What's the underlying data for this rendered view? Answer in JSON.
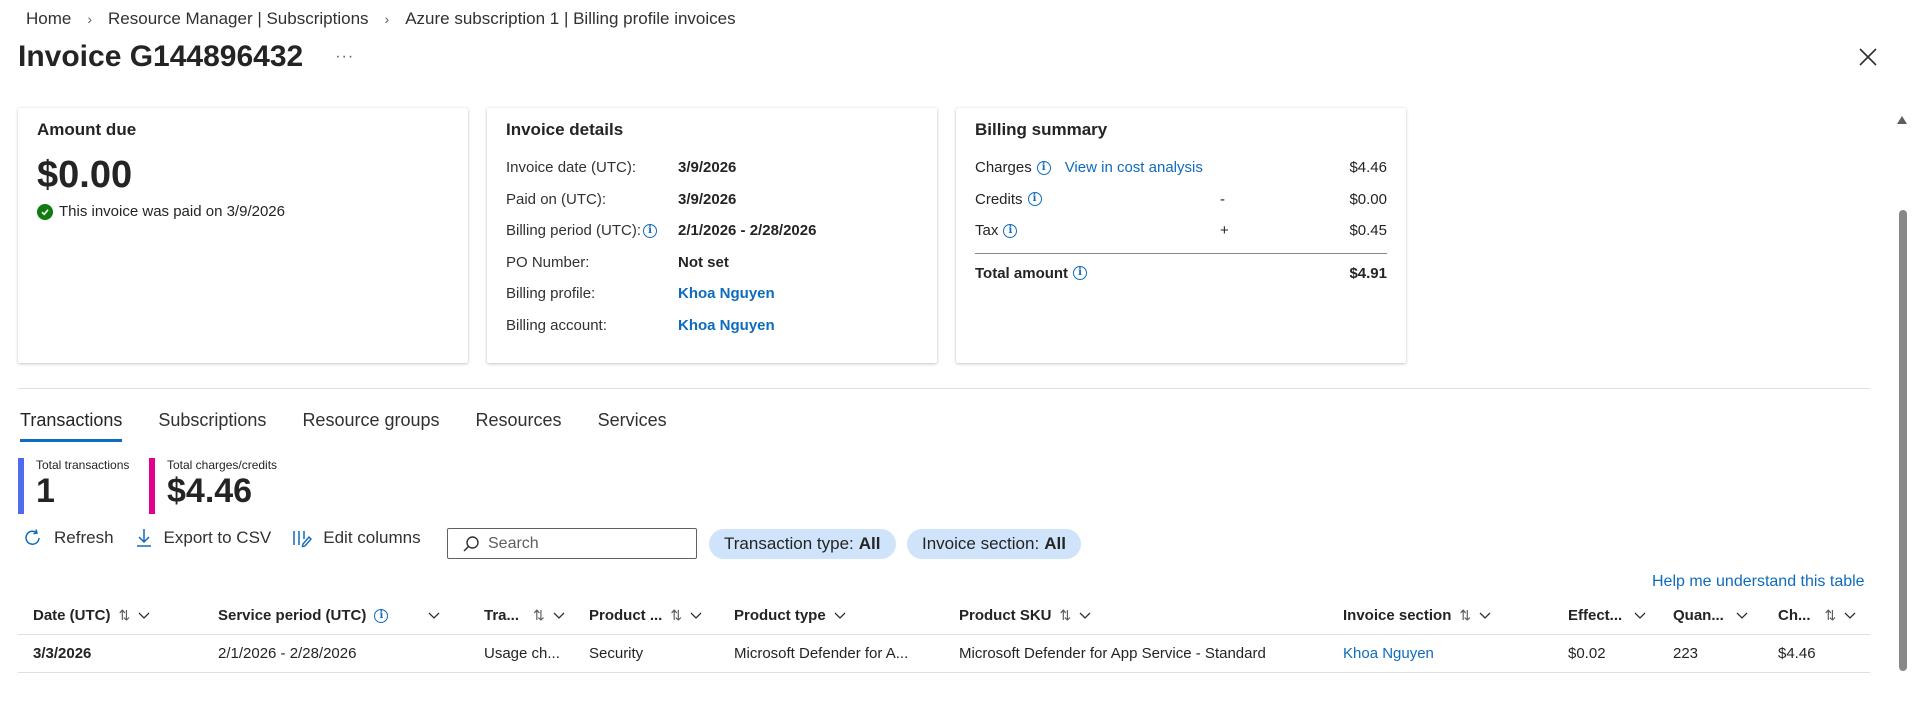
{
  "breadcrumb": {
    "items": [
      "Home",
      "Resource Manager | Subscriptions",
      "Azure subscription 1 | Billing profile invoices"
    ]
  },
  "page": {
    "title": "Invoice G144896432",
    "more_label": "···",
    "close_icon": "close-icon"
  },
  "amount_due": {
    "heading": "Amount due",
    "amount": "$0.00",
    "paid_text": "This invoice was paid on 3/9/2026",
    "status_color": "#107c10"
  },
  "invoice_details": {
    "heading": "Invoice details",
    "rows": [
      {
        "label": "Invoice date (UTC):",
        "value": "3/9/2026"
      },
      {
        "label": "Paid on (UTC):",
        "value": "3/9/2026"
      },
      {
        "label": "Billing period (UTC):",
        "value": "2/1/2026 - 2/28/2026"
      },
      {
        "label": "PO Number:",
        "value": "Not set"
      },
      {
        "label": "Billing profile:",
        "value": "Khoa Nguyen"
      },
      {
        "label": "Billing account:",
        "value": "Khoa Nguyen"
      }
    ]
  },
  "billing_summary": {
    "heading": "Billing summary",
    "charges_label": "Charges",
    "charges_link": "View in cost analysis",
    "charges_amount": "$4.46",
    "credits_label": "Credits",
    "credits_sign": "-",
    "credits_amount": "$0.00",
    "tax_label": "Tax",
    "tax_sign": "+",
    "tax_amount": "$0.45",
    "total_label": "Total amount",
    "total_amount": "$4.91"
  },
  "tabs": [
    "Transactions",
    "Subscriptions",
    "Resource groups",
    "Resources",
    "Services"
  ],
  "stats": {
    "transactions_label": "Total transactions",
    "transactions_value": "1",
    "transactions_color": "#4f6bed",
    "charges_label": "Total charges/credits",
    "charges_value": "$4.46",
    "charges_color": "#e3008c"
  },
  "toolbar": {
    "refresh": "Refresh",
    "export": "Export to CSV",
    "edit_columns": "Edit columns",
    "search_placeholder": "Search",
    "filter_type_label": "Transaction type:",
    "filter_type_value": "All",
    "filter_section_label": "Invoice section:",
    "filter_section_value": "All"
  },
  "help_link": "Help me understand this table",
  "table": {
    "headers": [
      "Date (UTC)",
      "Service period (UTC)",
      "Tra...",
      "Product ...",
      "Product type",
      "Product SKU",
      "Invoice section",
      "Effect...",
      "Quan...",
      "Ch..."
    ],
    "rows": [
      {
        "date": "3/3/2026",
        "service_period": "2/1/2026 - 2/28/2026",
        "transaction": "Usage ch...",
        "product": "Security",
        "product_type": "Microsoft Defender for A...",
        "sku": "Microsoft Defender for App Service - Standard",
        "invoice_section": "Khoa Nguyen",
        "effective": "$0.02",
        "quantity": "223",
        "charges": "$4.46"
      }
    ]
  },
  "colors": {
    "accent": "#0f6cbd",
    "pill_bg": "#cfe4fa"
  }
}
